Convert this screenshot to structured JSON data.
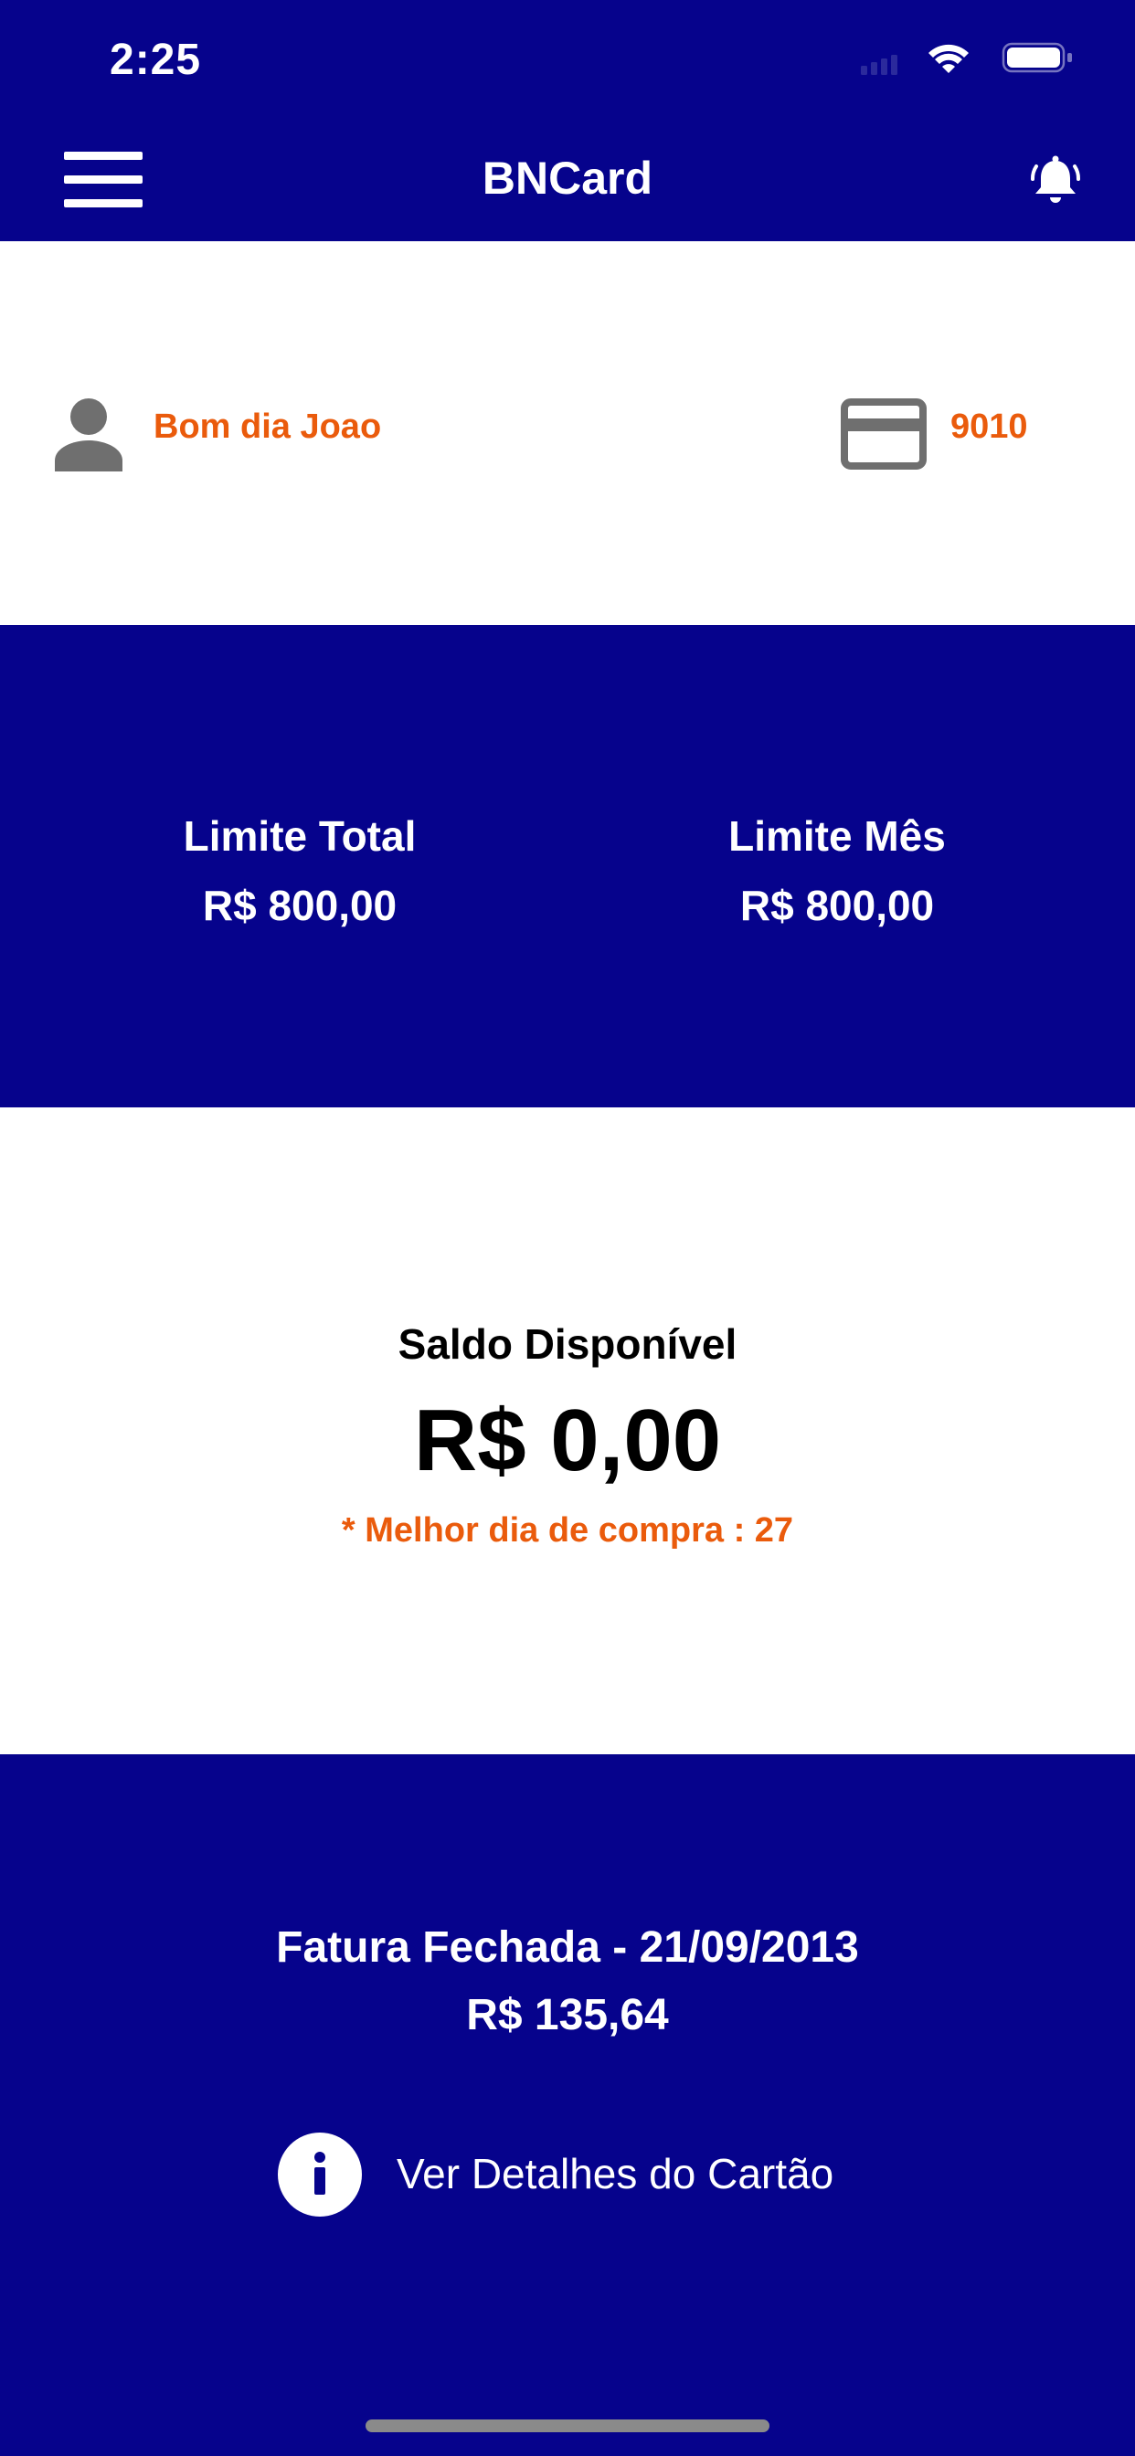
{
  "status_bar": {
    "time": "2:25"
  },
  "nav_bar": {
    "title": "BNCard",
    "menu_icon": "hamburger-menu-icon",
    "notification_icon": "bell-icon"
  },
  "user": {
    "greeting": "Bom dia Joao",
    "avatar_icon": "person-icon",
    "card_icon": "credit-card-icon",
    "card_last_digits": "9010"
  },
  "limits": {
    "total_label": "Limite Total",
    "total_value": "R$ 800,00",
    "month_label": "Limite Mês",
    "month_value": "R$ 800,00"
  },
  "balance": {
    "label": "Saldo Disponível",
    "value": "R$ 0,00",
    "best_day_note": "* Melhor dia de compra : 27"
  },
  "invoice": {
    "title": "Fatura Fechada - 21/09/2013",
    "value": "R$ 135,64",
    "details_label": "Ver Detalhes do Cartão",
    "details_icon": "info-icon"
  },
  "colors": {
    "primary_blue": "#06038c",
    "accent_orange": "#ea5b0c",
    "icon_gray": "#6f6f6f",
    "white": "#ffffff"
  }
}
